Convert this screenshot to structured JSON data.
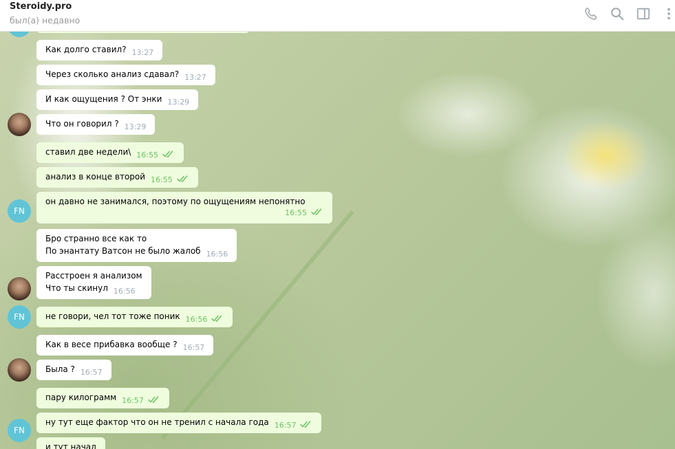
{
  "header": {
    "title": "Steroidy.pro",
    "status": "был(а) недавно"
  },
  "messages": [
    {
      "text": [
        "Как долго ставил?"
      ],
      "time": "13:27",
      "out": false
    },
    {
      "text": [
        "Через сколько анализ сдавал?"
      ],
      "time": "13:27",
      "out": false
    },
    {
      "text": [
        "И как ощущения ? От энки"
      ],
      "time": "13:29",
      "out": false
    },
    {
      "text": [
        "Что он говорил ?"
      ],
      "time": "13:29",
      "out": false
    },
    {
      "text": [
        "ставил две недели\\"
      ],
      "time": "16:55",
      "out": true
    },
    {
      "text": [
        "анализ в конце второй"
      ],
      "time": "16:55",
      "out": true
    },
    {
      "text": [
        "он давно не занимался, поэтому по ощущениям непонятно"
      ],
      "time": "16:55",
      "out": true
    },
    {
      "text": [
        "Бро странно все как то",
        "По энантату Ватсон не было жалоб"
      ],
      "time": "16:56",
      "out": false
    },
    {
      "text": [
        "Расстроен я анализом",
        "Что ты скинул"
      ],
      "time": "16:56",
      "out": false
    },
    {
      "text": [
        "не говори, чел тот тоже поник"
      ],
      "time": "16:56",
      "out": true
    },
    {
      "text": [
        "Как в весе прибавка вообще ?"
      ],
      "time": "16:57",
      "out": false
    },
    {
      "text": [
        "Была ?"
      ],
      "time": "16:57",
      "out": false
    },
    {
      "text": [
        "пару килограмм"
      ],
      "time": "16:57",
      "out": true
    },
    {
      "text": [
        "ну тут еще фактор что он не тренил с начала года"
      ],
      "time": "16:57",
      "out": true
    },
    {
      "text": [
        "и тут начал"
      ],
      "time": "",
      "out": true
    }
  ],
  "avatars": {
    "fn_initials": "FN"
  },
  "colors": {
    "incoming_bubble": "#ffffff",
    "outgoing_bubble": "#effdde",
    "read_check": "#6cc264",
    "fn_avatar": "#61c4d6"
  },
  "icons": [
    "phone-icon",
    "search-icon",
    "sidebar-toggle-icon",
    "more-vertical-icon",
    "double-check-icon"
  ]
}
